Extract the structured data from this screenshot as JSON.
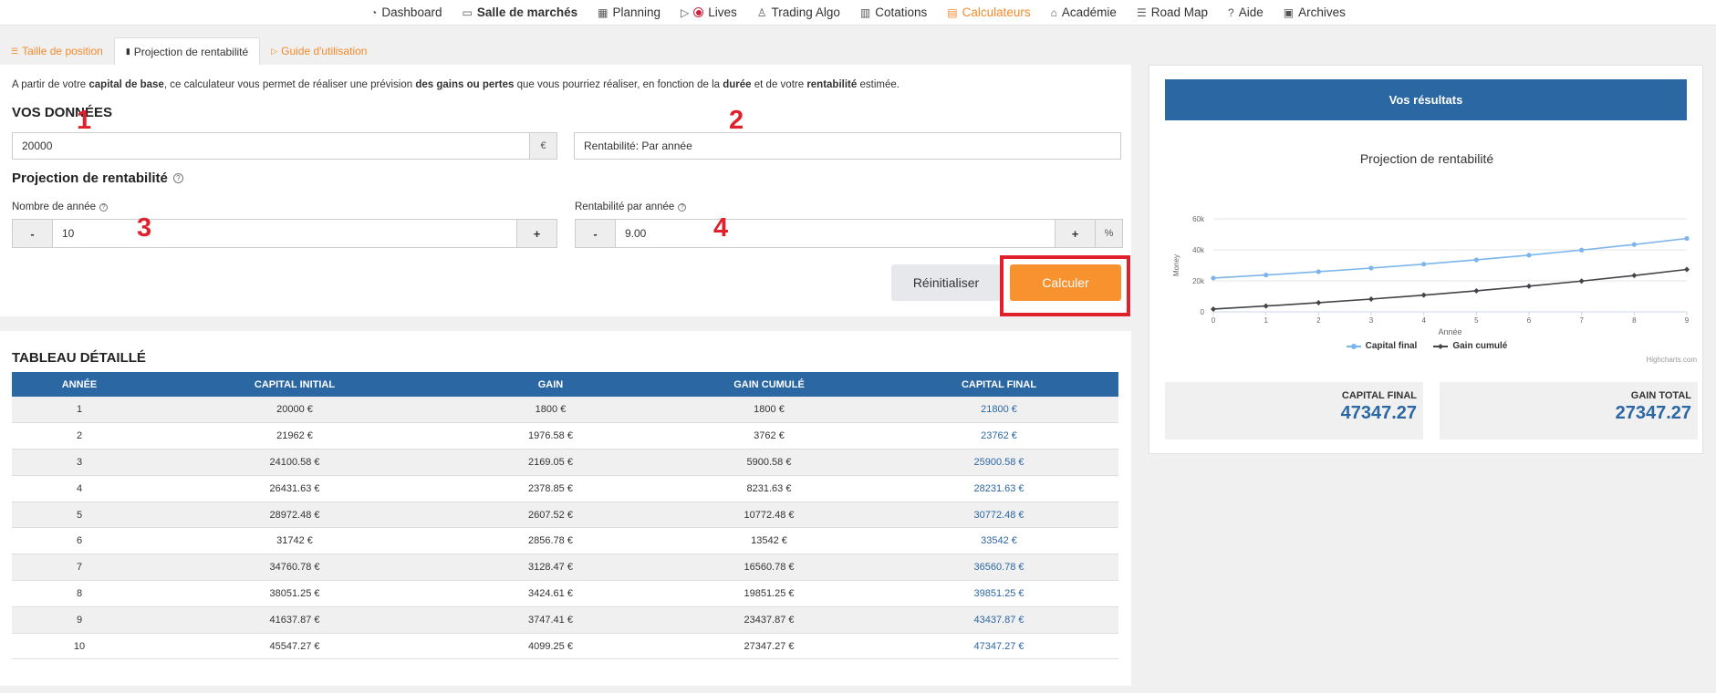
{
  "nav": [
    {
      "icon": "dashboard-icon",
      "glyph": "◔",
      "label": "Dashboard",
      "bold": false,
      "active": false
    },
    {
      "icon": "chat-icon",
      "glyph": "▭",
      "label": "Salle de marchés",
      "bold": true,
      "active": false
    },
    {
      "icon": "calendar-icon",
      "glyph": "▦",
      "label": "Planning",
      "bold": false,
      "active": false
    },
    {
      "icon": "video-icon",
      "glyph": "▷",
      "label": "Lives",
      "bold": false,
      "active": false,
      "rec": true
    },
    {
      "icon": "robot-icon",
      "glyph": "♙",
      "label": "Trading Algo",
      "bold": false,
      "active": false
    },
    {
      "icon": "chart-icon",
      "glyph": "▥",
      "label": "Cotations",
      "bold": false,
      "active": false
    },
    {
      "icon": "calculator-icon",
      "glyph": "▤",
      "label": "Calculateurs",
      "bold": false,
      "active": true
    },
    {
      "icon": "graduation-icon",
      "glyph": "⌂",
      "label": "Académie",
      "bold": false,
      "active": false
    },
    {
      "icon": "list-icon",
      "glyph": "☰",
      "label": "Road Map",
      "bold": false,
      "active": false
    },
    {
      "icon": "help-icon",
      "glyph": "?",
      "label": "Aide",
      "bold": false,
      "active": false
    },
    {
      "icon": "archive-icon",
      "glyph": "▣",
      "label": "Archives",
      "bold": false,
      "active": false
    }
  ],
  "tabs": {
    "position": "Taille de position",
    "projection": "Projection de rentabilité",
    "guide": "Guide d'utilisation"
  },
  "intro": {
    "t1": "A partir de votre ",
    "b1": "capital de base",
    "t2": ", ce calculateur vous permet de réaliser une prévision ",
    "b2": "des gains ou pertes",
    "t3": " que vous pourriez réaliser, en fonction de la ",
    "b3": "durée",
    "t4": " et de votre ",
    "b4": "rentabilité",
    "t5": " estimée."
  },
  "form": {
    "section_title": "VOS DONNÉES",
    "capital_value": "20000",
    "currency": "€",
    "rentabilite_select": "Rentabilité: Par année",
    "projection_title": "Projection de rentabilité",
    "years_label": "Nombre de année",
    "years_value": "10",
    "rate_label": "Rentabilité par année",
    "rate_value": "9.00",
    "percent": "%",
    "minus": "-",
    "plus": "+",
    "reset_label": "Réinitialiser",
    "calc_label": "Calculer"
  },
  "annotations": [
    "1",
    "2",
    "3",
    "4"
  ],
  "table": {
    "title": "TABLEAU DÉTAILLÉ",
    "headers": [
      "ANNÉE",
      "CAPITAL INITIAL",
      "GAIN",
      "GAIN CUMULÉ",
      "CAPITAL FINAL"
    ],
    "rows": [
      [
        "1",
        "20000 €",
        "1800 €",
        "1800 €",
        "21800 €"
      ],
      [
        "2",
        "21962 €",
        "1976.58 €",
        "3762 €",
        "23762 €"
      ],
      [
        "3",
        "24100.58 €",
        "2169.05 €",
        "5900.58 €",
        "25900.58 €"
      ],
      [
        "4",
        "26431.63 €",
        "2378.85 €",
        "8231.63 €",
        "28231.63 €"
      ],
      [
        "5",
        "28972.48 €",
        "2607.52 €",
        "10772.48 €",
        "30772.48 €"
      ],
      [
        "6",
        "31742 €",
        "2856.78 €",
        "13542 €",
        "33542 €"
      ],
      [
        "7",
        "34760.78 €",
        "3128.47 €",
        "16560.78 €",
        "36560.78 €"
      ],
      [
        "8",
        "38051.25 €",
        "3424.61 €",
        "19851.25 €",
        "39851.25 €"
      ],
      [
        "9",
        "41637.87 €",
        "3747.41 €",
        "23437.87 €",
        "43437.87 €"
      ],
      [
        "10",
        "45547.27 €",
        "4099.25 €",
        "27347.27 €",
        "47347.27 €"
      ]
    ]
  },
  "results": {
    "header": "Vos résultats",
    "capital_final_label": "CAPITAL FINAL",
    "capital_final_value": "47347.27",
    "gain_total_label": "GAIN TOTAL",
    "gain_total_value": "27347.27",
    "credit": "Highcharts.com"
  },
  "chart_data": {
    "type": "line",
    "title": "Projection de rentabilité",
    "xlabel": "Année",
    "ylabel": "Money",
    "x": [
      0,
      1,
      2,
      3,
      4,
      5,
      6,
      7,
      8,
      9
    ],
    "ylim": [
      0,
      60000
    ],
    "ytick_labels": [
      "0",
      "20k",
      "40k",
      "60k"
    ],
    "yticks": [
      0,
      20000,
      40000,
      60000
    ],
    "series": [
      {
        "name": "Capital final",
        "color": "#7cb5ec",
        "values": [
          21800,
          23762,
          25900.58,
          28231.63,
          30772.48,
          33542,
          36560.78,
          39851.25,
          43437.87,
          47347.27
        ]
      },
      {
        "name": "Gain cumulé",
        "color": "#434348",
        "values": [
          1800,
          3762,
          5900.58,
          8231.63,
          10772.48,
          13542,
          16560.78,
          19851.25,
          23437.87,
          27347.27
        ]
      }
    ],
    "grid": true,
    "legend": "bottom-center"
  }
}
